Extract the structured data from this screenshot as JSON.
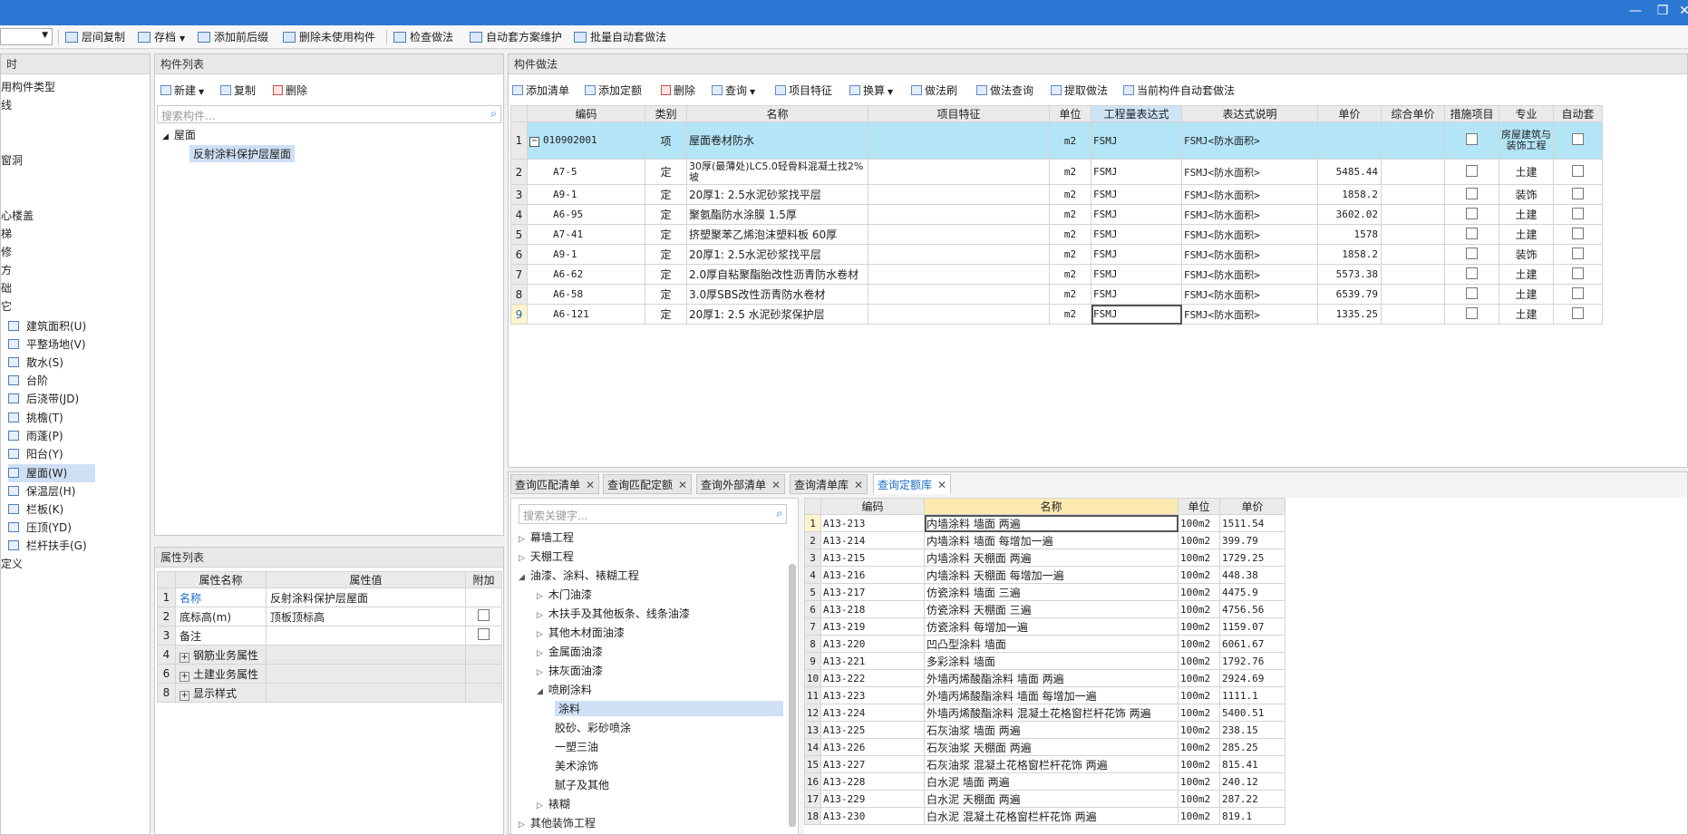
{
  "window": {
    "minimize": "—",
    "restore": "❐",
    "close": "✕"
  },
  "toolbar": {
    "items": [
      "层间复制",
      "存档",
      "添加前后缀",
      "删除未使用构件",
      "检查做法",
      "自动套方案维护",
      "批量自动套做法"
    ]
  },
  "left_nav": {
    "header": "时",
    "items": [
      "用构件类型",
      "线",
      "窗洞",
      "心楼盖",
      "梯",
      "修",
      "方",
      "础",
      "它",
      "建筑面积(U)",
      "平整场地(V)",
      "散水(S)",
      "台阶",
      "后浇带(JD)",
      "挑檐(T)",
      "雨蓬(P)",
      "阳台(Y)",
      "屋面(W)",
      "保温层(H)",
      "栏板(K)",
      "压顶(YD)",
      "栏杆扶手(G)",
      "定义"
    ]
  },
  "component_list": {
    "title": "构件列表",
    "new_label": "新建",
    "copy_label": "复制",
    "delete_label": "删除",
    "search_placeholder": "搜索构件...",
    "tree_root": "屋面",
    "tree_child": "反射涂料保护层屋面"
  },
  "property_list": {
    "title": "属性列表",
    "headers": [
      "属性名称",
      "属性值",
      "附加"
    ],
    "rows": [
      {
        "num": "1",
        "name": "名称",
        "value": "反射涂料保护层屋面",
        "check": false
      },
      {
        "num": "2",
        "name": "底标高(m)",
        "value": "顶板顶标高",
        "check": true
      },
      {
        "num": "3",
        "name": "备注",
        "value": "",
        "check": true
      },
      {
        "num": "4",
        "name": "钢筋业务属性",
        "value": "",
        "check": false
      },
      {
        "num": "6",
        "name": "土建业务属性",
        "value": "",
        "check": false
      },
      {
        "num": "8",
        "name": "显示样式",
        "value": "",
        "check": false
      }
    ]
  },
  "method": {
    "title": "构件做法",
    "tools": [
      "添加清单",
      "添加定额",
      "删除",
      "查询",
      "项目特征",
      "换算",
      "做法刷",
      "做法查询",
      "提取做法",
      "当前构件自动套做法"
    ],
    "headers": [
      "编码",
      "类别",
      "名称",
      "项目特征",
      "单位",
      "工程量表达式",
      "表达式说明",
      "单价",
      "综合单价",
      "措施项目",
      "专业",
      "自动套"
    ],
    "rows": [
      {
        "num": "1",
        "code": "010902001",
        "type": "项",
        "name": "屋面卷材防水",
        "unit": "m2",
        "expr": "FSMJ",
        "desc": "FSMJ<防水面积>",
        "price": "",
        "major": "房屋建筑与装饰工程"
      },
      {
        "num": "2",
        "code": "A7-5",
        "type": "定",
        "name": "30厚(最薄处)LC5.0轻骨料混凝土找2%坡",
        "unit": "m2",
        "expr": "FSMJ",
        "desc": "FSMJ<防水面积>",
        "price": "5485.44",
        "major": "土建"
      },
      {
        "num": "3",
        "code": "A9-1",
        "type": "定",
        "name": "20厚1: 2.5水泥砂浆找平层",
        "unit": "m2",
        "expr": "FSMJ",
        "desc": "FSMJ<防水面积>",
        "price": "1858.2",
        "major": "装饰"
      },
      {
        "num": "4",
        "code": "A6-95",
        "type": "定",
        "name": "聚氨酯防水涂膜 1.5厚",
        "unit": "m2",
        "expr": "FSMJ",
        "desc": "FSMJ<防水面积>",
        "price": "3602.02",
        "major": "土建"
      },
      {
        "num": "5",
        "code": "A7-41",
        "type": "定",
        "name": "挤塑聚苯乙烯泡沫塑料板  60厚",
        "unit": "m2",
        "expr": "FSMJ",
        "desc": "FSMJ<防水面积>",
        "price": "1578",
        "major": "土建"
      },
      {
        "num": "6",
        "code": "A9-1",
        "type": "定",
        "name": "20厚1: 2.5水泥砂浆找平层",
        "unit": "m2",
        "expr": "FSMJ",
        "desc": "FSMJ<防水面积>",
        "price": "1858.2",
        "major": "装饰"
      },
      {
        "num": "7",
        "code": "A6-62",
        "type": "定",
        "name": "2.0厚自粘聚酯胎改性沥青防水卷材",
        "unit": "m2",
        "expr": "FSMJ",
        "desc": "FSMJ<防水面积>",
        "price": "5573.38",
        "major": "土建"
      },
      {
        "num": "8",
        "code": "A6-58",
        "type": "定",
        "name": "3.0厚SBS改性沥青防水卷材",
        "unit": "m2",
        "expr": "FSMJ",
        "desc": "FSMJ<防水面积>",
        "price": "6539.79",
        "major": "土建"
      },
      {
        "num": "9",
        "code": "A6-121",
        "type": "定",
        "name": "20厚1: 2.5 水泥砂浆保护层",
        "unit": "m2",
        "expr": "FSMJ",
        "desc": "FSMJ<防水面积>",
        "price": "1335.25",
        "major": "土建"
      }
    ]
  },
  "query": {
    "tabs": [
      "查询匹配清单",
      "查询匹配定额",
      "查询外部清单",
      "查询清单库",
      "查询定额库"
    ],
    "search_placeholder": "搜索关键字...",
    "tree": [
      {
        "label": "幕墙工程",
        "level": 0,
        "arrow": "▷"
      },
      {
        "label": "天棚工程",
        "level": 0,
        "arrow": "▷"
      },
      {
        "label": "油漆、涂料、裱糊工程",
        "level": 0,
        "arrow": "◢"
      },
      {
        "label": "木门油漆",
        "level": 1,
        "arrow": "▷"
      },
      {
        "label": "木扶手及其他板条、线条油漆",
        "level": 1,
        "arrow": "▷"
      },
      {
        "label": "其他木材面油漆",
        "level": 1,
        "arrow": "▷"
      },
      {
        "label": "金属面油漆",
        "level": 1,
        "arrow": "▷"
      },
      {
        "label": "抹灰面油漆",
        "level": 1,
        "arrow": "▷"
      },
      {
        "label": "喷刷涂料",
        "level": 1,
        "arrow": "◢"
      },
      {
        "label": "涂料",
        "level": 2,
        "arrow": ""
      },
      {
        "label": "胶砂、彩砂喷涂",
        "level": 2,
        "arrow": ""
      },
      {
        "label": "一塑三油",
        "level": 2,
        "arrow": ""
      },
      {
        "label": "美术涂饰",
        "level": 2,
        "arrow": ""
      },
      {
        "label": "腻子及其他",
        "level": 2,
        "arrow": ""
      },
      {
        "label": "裱糊",
        "level": 1,
        "arrow": "▷"
      },
      {
        "label": "其他装饰工程",
        "level": 0,
        "arrow": "▷"
      }
    ],
    "headers": [
      "编码",
      "名称",
      "单位",
      "单价"
    ],
    "rows": [
      {
        "num": "1",
        "code": "A13-213",
        "name": "内墙涂料 墙面 两遍",
        "unit": "100m2",
        "price": "1511.54"
      },
      {
        "num": "2",
        "code": "A13-214",
        "name": "内墙涂料 墙面 每增加一遍",
        "unit": "100m2",
        "price": "399.79"
      },
      {
        "num": "3",
        "code": "A13-215",
        "name": "内墙涂料 天棚面 两遍",
        "unit": "100m2",
        "price": "1729.25"
      },
      {
        "num": "4",
        "code": "A13-216",
        "name": "内墙涂料 天棚面 每增加一遍",
        "unit": "100m2",
        "price": "448.38"
      },
      {
        "num": "5",
        "code": "A13-217",
        "name": "仿瓷涂料 墙面 三遍",
        "unit": "100m2",
        "price": "4475.9"
      },
      {
        "num": "6",
        "code": "A13-218",
        "name": "仿瓷涂料 天棚面 三遍",
        "unit": "100m2",
        "price": "4756.56"
      },
      {
        "num": "7",
        "code": "A13-219",
        "name": "仿瓷涂料 每增加一遍",
        "unit": "100m2",
        "price": "1159.07"
      },
      {
        "num": "8",
        "code": "A13-220",
        "name": "凹凸型涂料 墙面",
        "unit": "100m2",
        "price": "6061.67"
      },
      {
        "num": "9",
        "code": "A13-221",
        "name": "多彩涂料 墙面",
        "unit": "100m2",
        "price": "1792.76"
      },
      {
        "num": "10",
        "code": "A13-222",
        "name": "外墙丙烯酸酯涂料 墙面 两遍",
        "unit": "100m2",
        "price": "2924.69"
      },
      {
        "num": "11",
        "code": "A13-223",
        "name": "外墙丙烯酸酯涂料 墙面 每增加一遍",
        "unit": "100m2",
        "price": "1111.1"
      },
      {
        "num": "12",
        "code": "A13-224",
        "name": "外墙丙烯酸酯涂料 混凝土花格窗栏杆花饰 两遍",
        "unit": "100m2",
        "price": "5400.51"
      },
      {
        "num": "13",
        "code": "A13-225",
        "name": "石灰油浆 墙面 两遍",
        "unit": "100m2",
        "price": "238.15"
      },
      {
        "num": "14",
        "code": "A13-226",
        "name": "石灰油浆 天棚面 两遍",
        "unit": "100m2",
        "price": "285.25"
      },
      {
        "num": "15",
        "code": "A13-227",
        "name": "石灰油浆 混凝土花格窗栏杆花饰 两遍",
        "unit": "100m2",
        "price": "815.41"
      },
      {
        "num": "16",
        "code": "A13-228",
        "name": "白水泥 墙面 两遍",
        "unit": "100m2",
        "price": "240.12"
      },
      {
        "num": "17",
        "code": "A13-229",
        "name": "白水泥 天棚面 两遍",
        "unit": "100m2",
        "price": "287.22"
      },
      {
        "num": "18",
        "code": "A13-230",
        "name": "白水泥 混凝土花格窗栏杆花饰 两遍",
        "unit": "100m2",
        "price": "819.1"
      }
    ]
  }
}
